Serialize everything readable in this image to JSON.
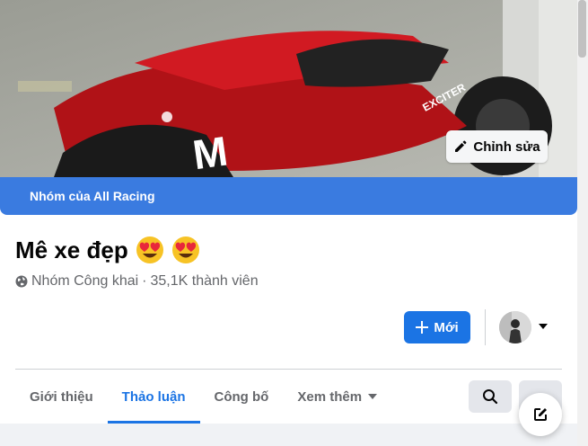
{
  "cover": {
    "edit_label": "Chỉnh sửa",
    "owner_label": "Nhóm của All Racing",
    "bike_brand_text": "EXCITER"
  },
  "group": {
    "title": "Mê xe đẹp",
    "title_emojis": [
      "heart-eyes-emoji",
      "heart-eyes-emoji"
    ],
    "privacy": "Nhóm Công khai",
    "separator": "·",
    "members": "35,1K thành viên"
  },
  "actions": {
    "new_label": "Mới"
  },
  "tabs": [
    {
      "label": "Giới thiệu",
      "active": false
    },
    {
      "label": "Thảo luận",
      "active": true
    },
    {
      "label": "Công bố",
      "active": false
    },
    {
      "label": "Xem thêm",
      "active": false
    }
  ],
  "colors": {
    "accent": "#1b74e4",
    "owner_bar": "#3a7be0",
    "text_secondary": "#65676b"
  }
}
